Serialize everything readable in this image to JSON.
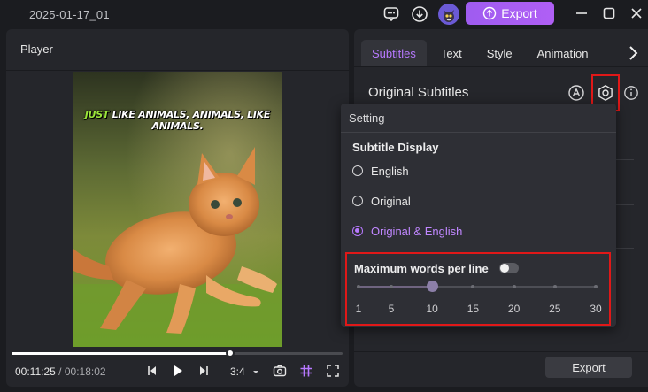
{
  "title_bar": {
    "project_name": "2025-01-17_01",
    "export_label": "Export",
    "icons": [
      "comment-icon",
      "download-icon",
      "avatar-icon"
    ],
    "accent": "#a55df2"
  },
  "player": {
    "title": "Player",
    "caption_highlight": "JUST",
    "caption_rest": " LIKE ANIMALS, ANIMALS, LIKE ANIMALS.",
    "current_time": "00:11:25",
    "separator": "/",
    "total_time": "00:18:02",
    "aspect_ratio": "3:4",
    "progress": 0.66
  },
  "right_panel": {
    "tabs": [
      {
        "label": "Subtitles",
        "active": true
      },
      {
        "label": "Text",
        "active": false
      },
      {
        "label": "Style",
        "active": false
      },
      {
        "label": "Animation",
        "active": false
      }
    ],
    "section_title": "Original Subtitles",
    "export_label": "Export"
  },
  "setting_popup": {
    "header": "Setting",
    "subtitle_display_title": "Subtitle Display",
    "options": [
      {
        "label": "English",
        "selected": false
      },
      {
        "label": "Original",
        "selected": false
      },
      {
        "label": "Original & English",
        "selected": true
      }
    ],
    "max_words_label": "Maximum words per line",
    "max_words_enabled": false,
    "slider_ticks": [
      "1",
      "5",
      "10",
      "15",
      "20",
      "25",
      "30"
    ],
    "slider_value": 10
  }
}
